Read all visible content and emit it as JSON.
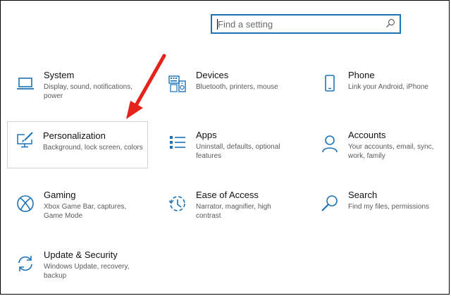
{
  "search": {
    "placeholder": "Find a setting",
    "icon": "search-icon"
  },
  "accent": "#1a73b8",
  "annotation_color": "#e5231b",
  "tiles": [
    {
      "title": "System",
      "description": "Display, sound, notifications, power",
      "icon": "laptop-icon"
    },
    {
      "title": "Devices",
      "description": "Bluetooth, printers, mouse",
      "icon": "keyboard-speaker-icon"
    },
    {
      "title": "Phone",
      "description": "Link your Android, iPhone",
      "icon": "phone-icon"
    },
    {
      "title": "Personalization",
      "description": "Background, lock screen, colors",
      "icon": "paintbrush-monitor-icon"
    },
    {
      "title": "Apps",
      "description": "Uninstall, defaults, optional features",
      "icon": "apps-list-icon"
    },
    {
      "title": "Accounts",
      "description": "Your accounts, email, sync, work, family",
      "icon": "person-icon"
    },
    {
      "title": "Gaming",
      "description": "Xbox Game Bar, captures, Game Mode",
      "icon": "xbox-icon"
    },
    {
      "title": "Ease of Access",
      "description": "Narrator, magnifier, high contrast",
      "icon": "ease-of-access-icon"
    },
    {
      "title": "Search",
      "description": "Find my files, permissions",
      "icon": "magnifier-icon"
    },
    {
      "title": "Update & Security",
      "description": "Windows Update, recovery, backup",
      "icon": "sync-arrows-icon"
    }
  ]
}
